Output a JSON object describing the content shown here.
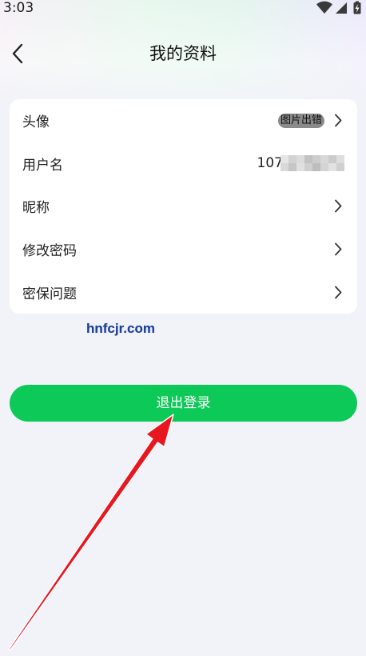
{
  "status_bar": {
    "time": "3:03",
    "icons": [
      "wifi-icon",
      "signal-icon",
      "battery-charging-icon"
    ]
  },
  "header": {
    "title": "我的资料",
    "back_icon": "back-chevron-icon"
  },
  "profile_rows": [
    {
      "label": "头像",
      "value": "图片出错",
      "trailing_icon": "chevron-right-icon"
    },
    {
      "label": "用户名",
      "value": "107"
    },
    {
      "label": "昵称",
      "trailing_icon": "chevron-right-icon"
    },
    {
      "label": "修改密码",
      "trailing_icon": "chevron-right-icon"
    },
    {
      "label": "密保问题",
      "trailing_icon": "chevron-right-icon"
    }
  ],
  "watermark": "hnfcjr.com",
  "logout_button": {
    "label": "退出登录"
  },
  "colors": {
    "page_background": "#f1f3f8",
    "card_background": "#ffffff",
    "accent_green": "#0dc957",
    "annotation_red": "#e8161e",
    "watermark_blue": "#1c3e9c"
  }
}
